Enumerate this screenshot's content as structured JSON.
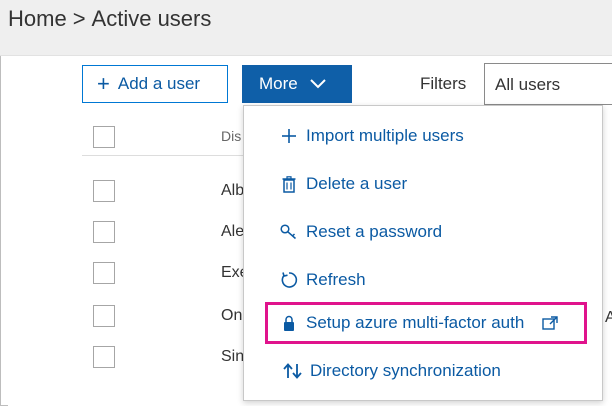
{
  "breadcrumb": {
    "home": "Home",
    "separator": ">",
    "current": "Active users"
  },
  "toolbar": {
    "add_user_label": "Add a user",
    "more_label": "More",
    "filters_label": "Filters",
    "filter_value": "All users"
  },
  "table": {
    "header_fragment": "Dis",
    "rows": [
      "Alb",
      "Ale",
      "Exe",
      "On",
      "Sin"
    ],
    "overflow_fragment": "A"
  },
  "more_menu": {
    "items": [
      {
        "label": "Import multiple users",
        "icon": "plus-icon"
      },
      {
        "label": "Delete a user",
        "icon": "trash-icon"
      },
      {
        "label": "Reset a password",
        "icon": "key-icon"
      },
      {
        "label": "Refresh",
        "icon": "refresh-icon"
      },
      {
        "label": "Setup azure multi-factor auth",
        "icon": "lock-icon",
        "trailing_icon": "external-link-icon",
        "highlighted": true
      },
      {
        "label": "Directory synchronization",
        "icon": "sync-arrows-icon"
      }
    ]
  },
  "colors": {
    "primary": "#0f5fa8",
    "link": "#0b5aa3",
    "highlight": "#e0138c",
    "band": "#efefef"
  }
}
